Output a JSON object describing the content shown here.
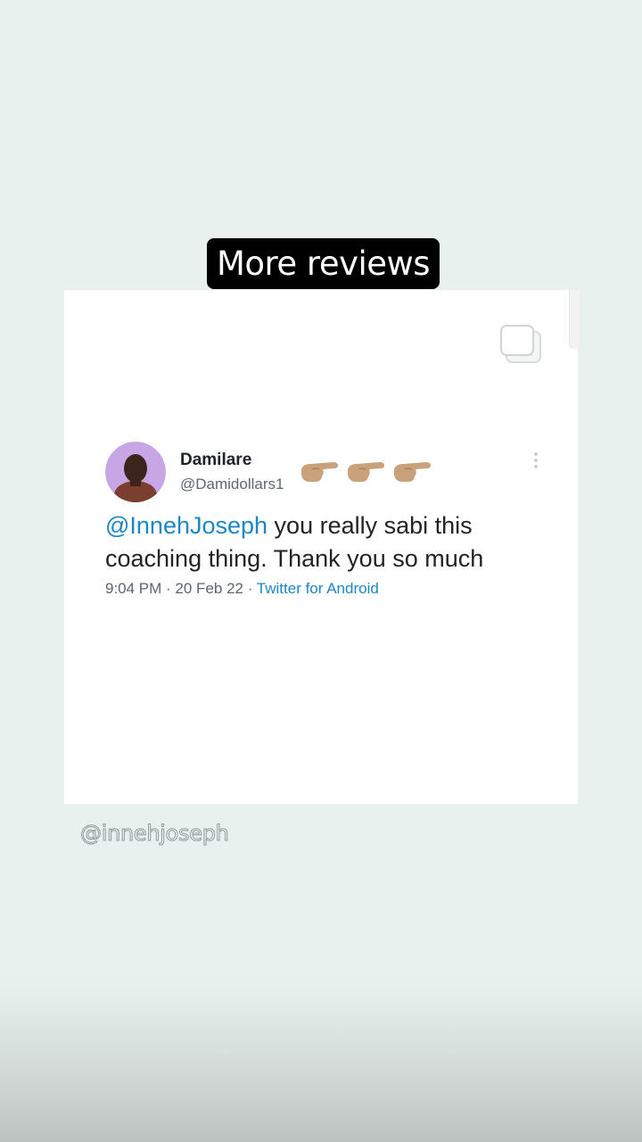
{
  "story": {
    "caption": "More reviews",
    "watermark": "@innehjoseph"
  },
  "tweet": {
    "display_name": "Damilare",
    "handle": "@Damidollars1",
    "emojis": [
      "backhand-index-pointing-right",
      "backhand-index-pointing-right",
      "backhand-index-pointing-right"
    ],
    "mention": "@InnehJoseph",
    "text_line1": " you really sabi this",
    "text_line2": "coaching thing. Thank you so much",
    "time": "9:04 PM",
    "date": "20 Feb 22",
    "source": "Twitter for Android",
    "separator": " · "
  },
  "colors": {
    "background": "#e9f1ef",
    "link": "#1d86c4",
    "caption_bg": "#000000"
  }
}
